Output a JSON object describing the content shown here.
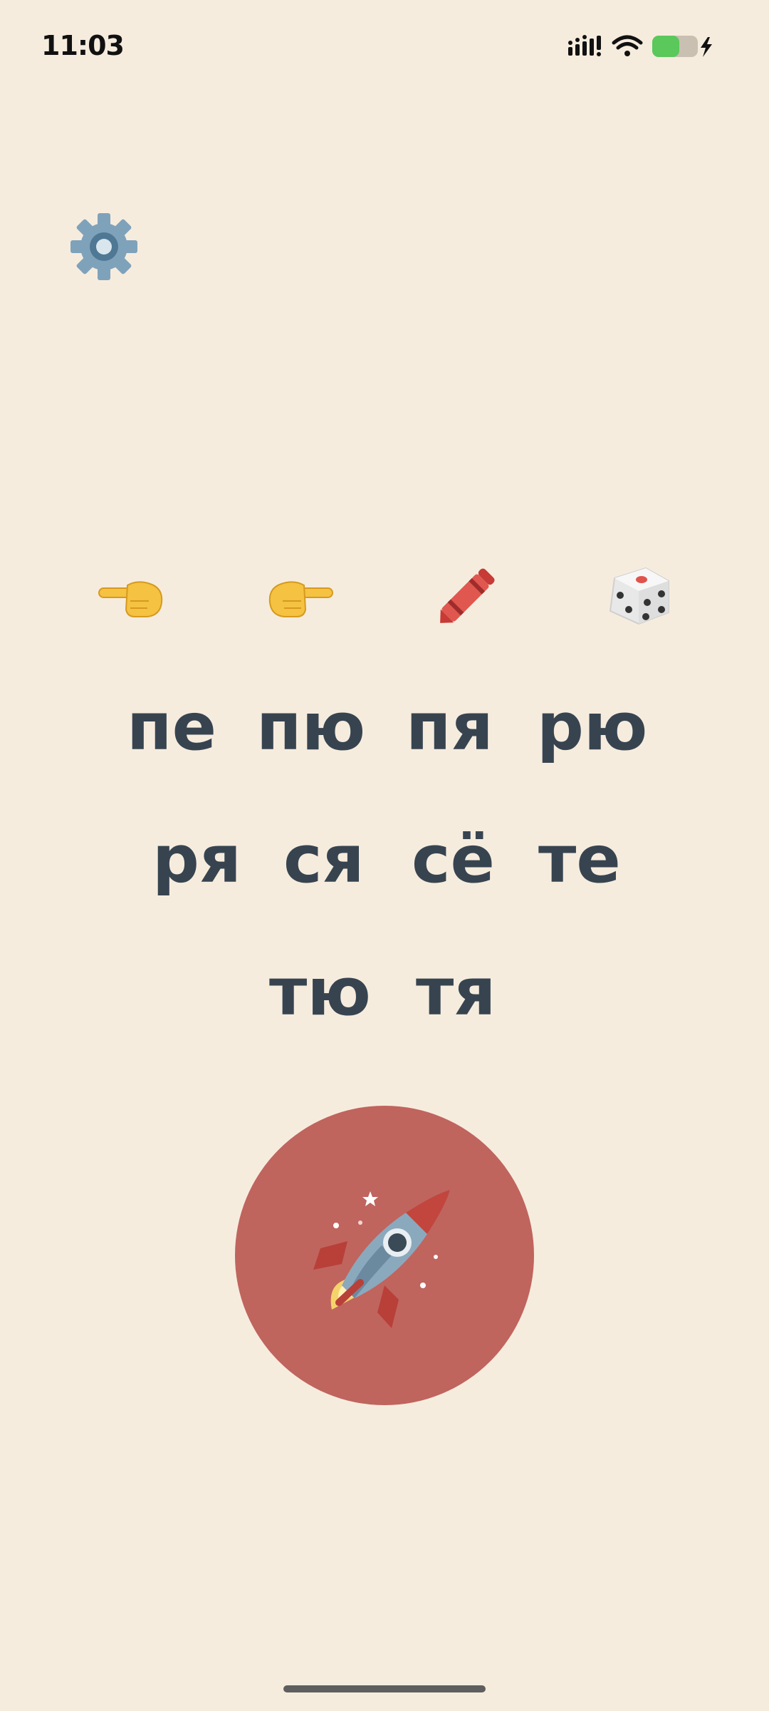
{
  "status_bar": {
    "time": "11:03",
    "icons": [
      "signal-icon",
      "wifi-icon",
      "battery-charging-icon"
    ]
  },
  "settings": {
    "icon": "gear-icon"
  },
  "tools": [
    {
      "name": "pointing-left-icon",
      "glyph": "👈"
    },
    {
      "name": "pointing-right-icon",
      "glyph": "👉"
    },
    {
      "name": "crayon-icon",
      "glyph": "🖍"
    },
    {
      "name": "dice-icon",
      "glyph": "🎲"
    }
  ],
  "syllables": {
    "row1": [
      "пе",
      "пю",
      "пя",
      "рю"
    ],
    "row2": [
      "ря",
      "ся",
      "сё",
      "те"
    ],
    "row3": [
      "тю",
      "тя"
    ]
  },
  "start_button": {
    "icon": "rocket-icon"
  },
  "colors": {
    "background": "#f6ecde",
    "text": "#374450",
    "button": "#c0645e",
    "battery": "#5ac85a"
  }
}
